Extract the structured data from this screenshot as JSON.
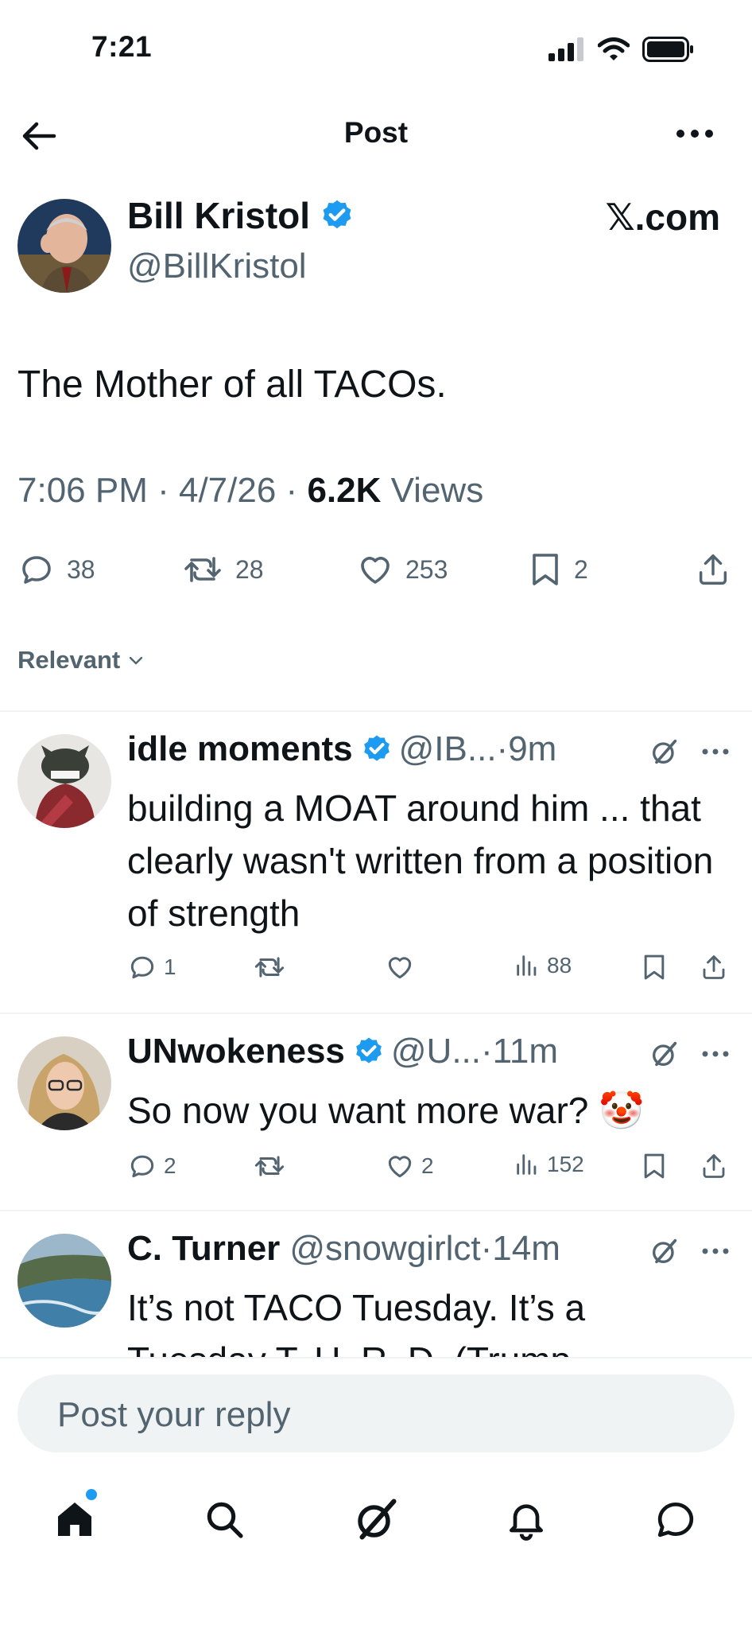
{
  "status": {
    "time": "7:21"
  },
  "header": {
    "title": "Post"
  },
  "post": {
    "author_name": "Bill Kristol",
    "author_handle": "@BillKristol",
    "source": "𝕏.com",
    "text": "The Mother of all TACOs.",
    "time": "7:06 PM",
    "date": "4/7/26",
    "views_count": "6.2K",
    "views_label": "Views",
    "replies": "38",
    "reposts": "28",
    "likes": "253",
    "bookmarks": "2"
  },
  "sort": {
    "label": "Relevant"
  },
  "replies": [
    {
      "name": "idle moments",
      "handle": "@IB...",
      "time": "9m",
      "text": "building a MOAT around him ... that clearly wasn't written from a position of strength",
      "reply_count": "1",
      "repost_count": "",
      "like_count": "",
      "views": "88"
    },
    {
      "name": "UNwokeness",
      "handle": "@U...",
      "time": "11m",
      "text": "So now you want more war? 🤡",
      "reply_count": "2",
      "repost_count": "",
      "like_count": "2",
      "views": "152"
    },
    {
      "name": "C. Turner",
      "handle": "@snowgirlct",
      "time": "14m",
      "text": "It’s not TACO Tuesday. It’s a Tuesday T. U. R. D. (Trump"
    }
  ],
  "reply_box": {
    "placeholder": "Post your reply"
  },
  "colors": {
    "accent": "#1d9bf0",
    "text": "#0f1419",
    "muted": "#536471",
    "border": "#eff3f4"
  },
  "icons": {
    "tabs": [
      "home-icon",
      "search-icon",
      "grok-icon",
      "notifications-icon",
      "messages-icon"
    ]
  }
}
